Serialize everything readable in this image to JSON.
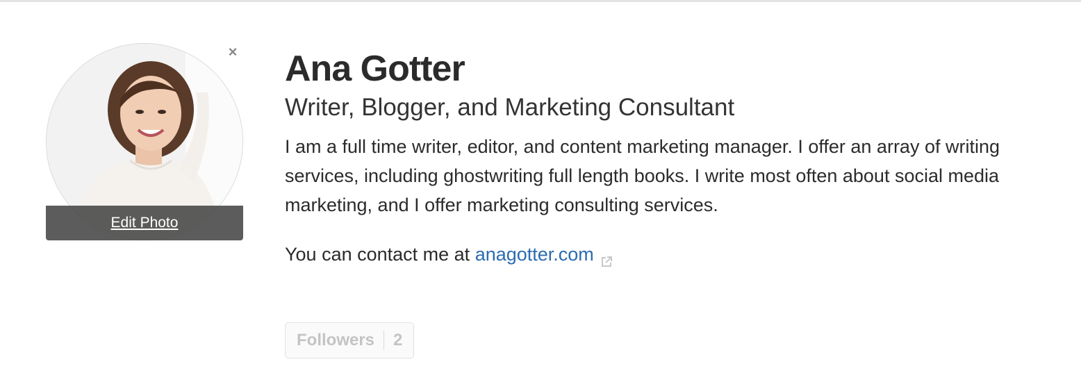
{
  "profile": {
    "name": "Ana Gotter",
    "tagline": "Writer, Blogger, and Marketing Consultant",
    "bio": "I am a full time writer, editor, and content marketing manager. I offer an array of writing services, including ghostwriting full length books. I write most often about social media marketing, and I offer marketing consulting services.",
    "contact_prefix": "You can contact me at ",
    "contact_link": "anagotter.com"
  },
  "photo": {
    "edit_label": "Edit Photo",
    "close_symbol": "×"
  },
  "followers": {
    "label": "Followers",
    "count": "2"
  },
  "colors": {
    "link": "#2b6cb0",
    "text": "#2b2b2b",
    "overlay": "#464646"
  },
  "icons": [
    "close-icon",
    "external-link-icon"
  ]
}
